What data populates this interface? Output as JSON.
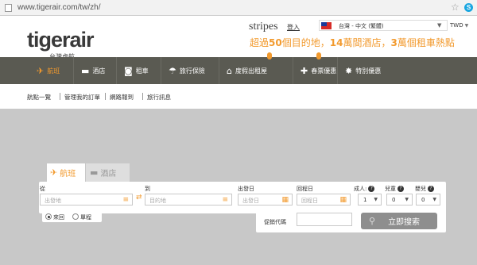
{
  "browser": {
    "url": "www.tigerair.com/tw/zh/"
  },
  "header": {
    "logo": "tigerair",
    "logo_sub": "台灣虎航",
    "stripes": "stripes",
    "login": "登入",
    "language": "台灣 - 中文 (繁體)",
    "currency": "TWD",
    "slogan": {
      "p1": "超過",
      "n1": "50",
      "p2": "個目的地，",
      "n2": "14",
      "p3": "萬間酒店，",
      "n3": "3",
      "p4": "萬個租車熱點"
    }
  },
  "nav": {
    "items": [
      {
        "label": "航班",
        "icon": "airplane-icon"
      },
      {
        "label": "酒店",
        "icon": "bed-icon"
      },
      {
        "label": "租車",
        "icon": "car-icon"
      },
      {
        "label": "旅行保險",
        "icon": "umbrella-icon"
      },
      {
        "label": "度假出租屋",
        "icon": "house-icon"
      },
      {
        "label": "春票優惠",
        "icon": "ticket-icon"
      },
      {
        "label": "特別優惠",
        "icon": "star-icon"
      }
    ]
  },
  "subnav": [
    "航點一覽",
    "管理我的訂單",
    "網路報到",
    "旅行訊息"
  ],
  "search": {
    "tabs": {
      "flight": "航班",
      "hotel": "酒店"
    },
    "from_label": "從",
    "from_placeholder": "出發地",
    "to_label": "到",
    "to_placeholder": "目的地",
    "depart_label": "出發日",
    "depart_placeholder": "出發日",
    "return_label": "回程日",
    "return_placeholder": "回程日",
    "adults_label": "成人:",
    "adults_value": "1",
    "children_label": "兒童",
    "children_value": "0",
    "infants_label": "嬰兒",
    "infants_value": "0",
    "trip_round": "來回",
    "trip_oneway": "單程",
    "promo_label": "促銷代碼",
    "search_button": "立即搜索"
  },
  "colors": {
    "accent": "#f29a2e",
    "nav_bg": "#5a5a52",
    "page_bg": "#c8c8c8"
  }
}
